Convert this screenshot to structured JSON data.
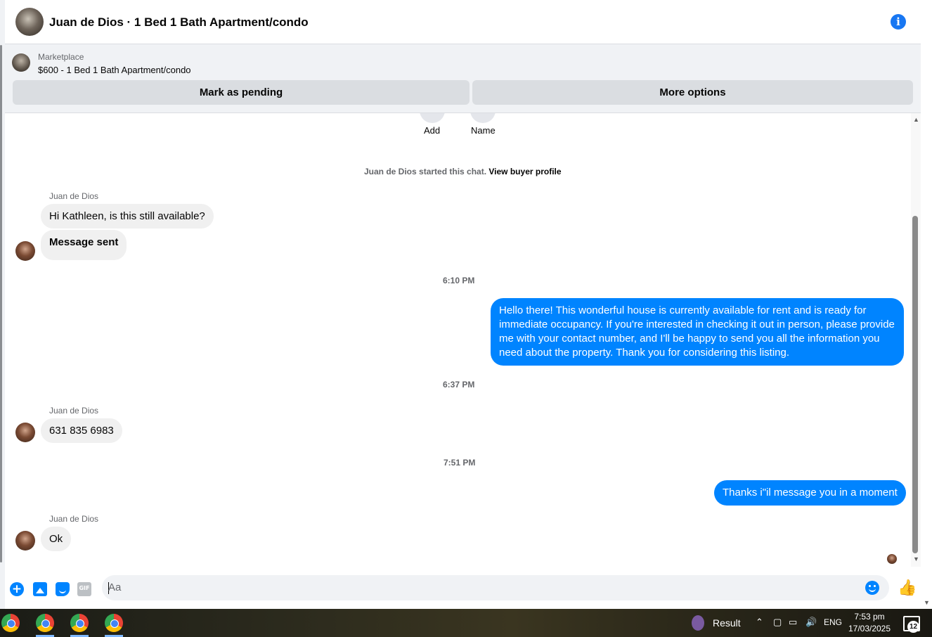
{
  "header": {
    "title": "Juan de Dios · 1 Bed 1 Bath Apartment/condo"
  },
  "banner": {
    "kicker": "Marketplace",
    "listing": "$600 - 1 Bed 1 Bath Apartment/condo",
    "mark_pending": "Mark as pending",
    "more_options": "More options"
  },
  "actions": {
    "add": "Add",
    "name": "Name"
  },
  "system": {
    "started": "Juan de Dios started this chat.",
    "view_profile": "View buyer profile"
  },
  "messages": {
    "sender": "Juan de Dios",
    "m1": "Hi Kathleen, is this still available?",
    "m2": "Message sent",
    "ts1": "6:10 PM",
    "m3": "Hello there! This wonderful house is currently available for rent and is ready for immediate occupancy. If you're interested in checking it out in person, please provide me with your contact number, and I'll be happy to send you all the information you need about the property. Thank you for considering this listing.",
    "ts2": "6:37 PM",
    "m4": "631 835 6983",
    "ts3": "7:51 PM",
    "m5": "Thanks i\"il message you in a moment",
    "m6": "Ok"
  },
  "composer": {
    "placeholder": "Aa",
    "gif": "GIF"
  },
  "taskbar": {
    "result": "Result",
    "language": "ENG",
    "time": "7:53 pm",
    "date": "17/03/2025",
    "notifications": "12"
  },
  "colors": {
    "accent": "#0084ff",
    "incoming_bubble": "#f0f0f0"
  }
}
